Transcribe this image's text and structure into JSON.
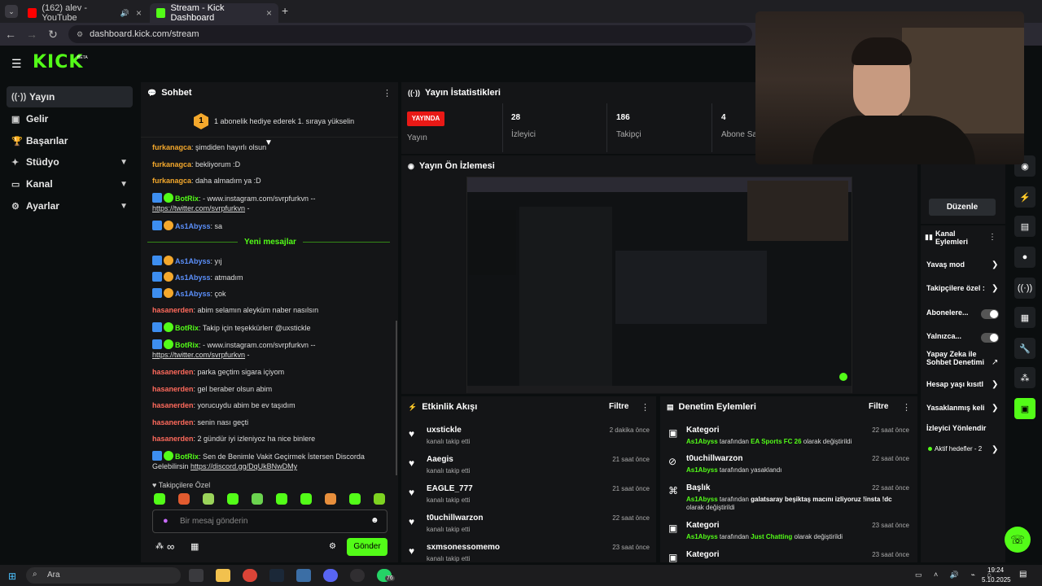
{
  "browser": {
    "tabs": [
      {
        "label": "(162) alev - YouTube",
        "active": false
      },
      {
        "label": "Stream - Kick Dashboard",
        "active": true
      }
    ],
    "url": "dashboard.kick.com/stream"
  },
  "header": {
    "logo": "KICK",
    "logo_badge": "BETA"
  },
  "sidebar": {
    "items": [
      {
        "label": "Yayın",
        "icon": "broadcast-icon"
      },
      {
        "label": "Gelir",
        "icon": "money-icon"
      },
      {
        "label": "Başarılar",
        "icon": "trophy-icon"
      },
      {
        "label": "Stüdyo",
        "icon": "studio-icon"
      },
      {
        "label": "Kanal",
        "icon": "channel-icon"
      },
      {
        "label": "Ayarlar",
        "icon": "gear-icon"
      }
    ]
  },
  "chat": {
    "title": "Sohbet",
    "pinned_rank": "1",
    "pinned_text": "1 abonelik hediye ederek 1. sıraya yükselin",
    "lines": [
      {
        "user": "furkanagca",
        "text": "şimdiden hayırlı olsun"
      },
      {
        "user": "furkanagca",
        "text": "bekliyorum :D"
      },
      {
        "user": "furkanagca",
        "text": "daha almadım ya :D"
      },
      {
        "user": "BotRix",
        "text": "- www.instagram.com/svrpfurkvn --",
        "link": "https://twitter.com/svrpfurkvn",
        "after": " -"
      },
      {
        "user": "As1Abyss",
        "text": "sa"
      }
    ],
    "new_messages": "Yeni mesajlar",
    "lines2": [
      {
        "user": "As1Abyss",
        "text": "yıj"
      },
      {
        "user": "As1Abyss",
        "text": "atmadım"
      },
      {
        "user": "As1Abyss",
        "text": "çok"
      },
      {
        "user": "hasanerden",
        "text": "abim selamın aleyküm naber nasılsın"
      },
      {
        "user": "BotRix",
        "text": "Takip için teşekkürlerr @uxstickle"
      },
      {
        "user": "BotRix",
        "text": "- www.instagram.com/svrpfurkvn --",
        "link": "https://twitter.com/svrpfurkvn",
        "after": " -"
      },
      {
        "user": "hasanerden",
        "text": "parka geçtim sigara içiyom"
      },
      {
        "user": "hasanerden",
        "text": "gel beraber olsun abim"
      },
      {
        "user": "hasanerden",
        "text": "yorucuydu abim be ev taşıdım"
      },
      {
        "user": "hasanerden",
        "text": "senin nası geçti"
      },
      {
        "user": "hasanerden",
        "text": "2 gündür iyi izleniyoz ha nice binlere"
      },
      {
        "user": "BotRix",
        "text": "Sen de Benimle Vakit Geçirmek İstersen Discorda Gelebilirsin",
        "link": "https://discord.gg/DqUkBNwDMy"
      }
    ],
    "emote_label": "Takipçilere Özel",
    "input_placeholder": "Bir mesaj gönderin",
    "send_label": "Gönder",
    "infinity": "∞"
  },
  "stats": {
    "title": "Yayın İstatistikleri",
    "live_badge": "YAYINDA",
    "live_label": "Yayın",
    "viewers": "28",
    "viewers_label": "İzleyici",
    "followers": "186",
    "followers_label": "Takipçi",
    "subs": "4",
    "subs_label": "Abone Sa"
  },
  "preview": {
    "title": "Yayın Ön İzlemesi"
  },
  "activity": {
    "title": "Etkinlik Akışı",
    "filter": "Filtre",
    "items": [
      {
        "name": "uxstickle",
        "sub": "kanalı takip etti",
        "time": "2 dakika önce"
      },
      {
        "name": "Aaegis",
        "sub": "kanalı takip etti",
        "time": "21 saat önce"
      },
      {
        "name": "EAGLE_777",
        "sub": "kanalı takip etti",
        "time": "21 saat önce"
      },
      {
        "name": "t0uchillwarzon",
        "sub": "kanalı takip etti",
        "time": "22 saat önce"
      },
      {
        "name": "sxmsonessomemo",
        "sub": "kanalı takip etti",
        "time": "23 saat önce"
      }
    ]
  },
  "moderation": {
    "title": "Denetim Eylemleri",
    "filter": "Filtre",
    "items": [
      {
        "title": "Kategori",
        "actor": "As1Abyss",
        "mid": " tarafından ",
        "value": "EA Sports FC 26",
        "tail": " olarak değiştirildi",
        "time": "22 saat önce"
      },
      {
        "title": "t0uchillwarzon",
        "actor": "As1Abyss",
        "mid": " tarafından yasaklandı",
        "value": "",
        "tail": "",
        "time": "22 saat önce"
      },
      {
        "title": "Başlık",
        "actor": "As1Abyss",
        "mid": " tarafından ",
        "value": "galatsaray beşiktaş macını izliyoruz !insta !dc",
        "tail": " olarak değiştirildi",
        "time": "22 saat önce"
      },
      {
        "title": "Kategori",
        "actor": "As1Abyss",
        "mid": " tarafından ",
        "value": "Just Chatting",
        "tail": " olarak değiştirildi",
        "time": "23 saat önce"
      },
      {
        "title": "Kategori",
        "actor": "",
        "mid": "",
        "value": "",
        "tail": "",
        "time": "23 saat önce"
      }
    ]
  },
  "channel_actions": {
    "edit_button": "Düzenle",
    "title": "Kanal Eylemleri",
    "items": [
      {
        "label": "Yavaş mod",
        "control": "chevron"
      },
      {
        "label": "Takipçilere özel :",
        "control": "chevron"
      },
      {
        "label": "Abonelere...",
        "control": "toggle"
      },
      {
        "label": "Yalnızca...",
        "control": "toggle"
      },
      {
        "label": "Yapay Zeka ile Sohbet Denetimi",
        "control": "external"
      },
      {
        "label": "Hesap yaşı kısıtl",
        "control": "chevron"
      },
      {
        "label": "Yasaklanmış keli",
        "control": "chevron"
      },
      {
        "label": "İzleyici Yönlendir",
        "control": "none"
      },
      {
        "label": "Aktif hedefler - 2",
        "control": "chevron"
      }
    ]
  },
  "taskbar": {
    "search": "Ara",
    "time": "19:24",
    "date": "5.10.2025",
    "whatsapp_badge": "76"
  },
  "colors": {
    "accent": "#53fc18",
    "live": "#e91916",
    "panel": "#141517",
    "bg": "#0b0e0f"
  }
}
